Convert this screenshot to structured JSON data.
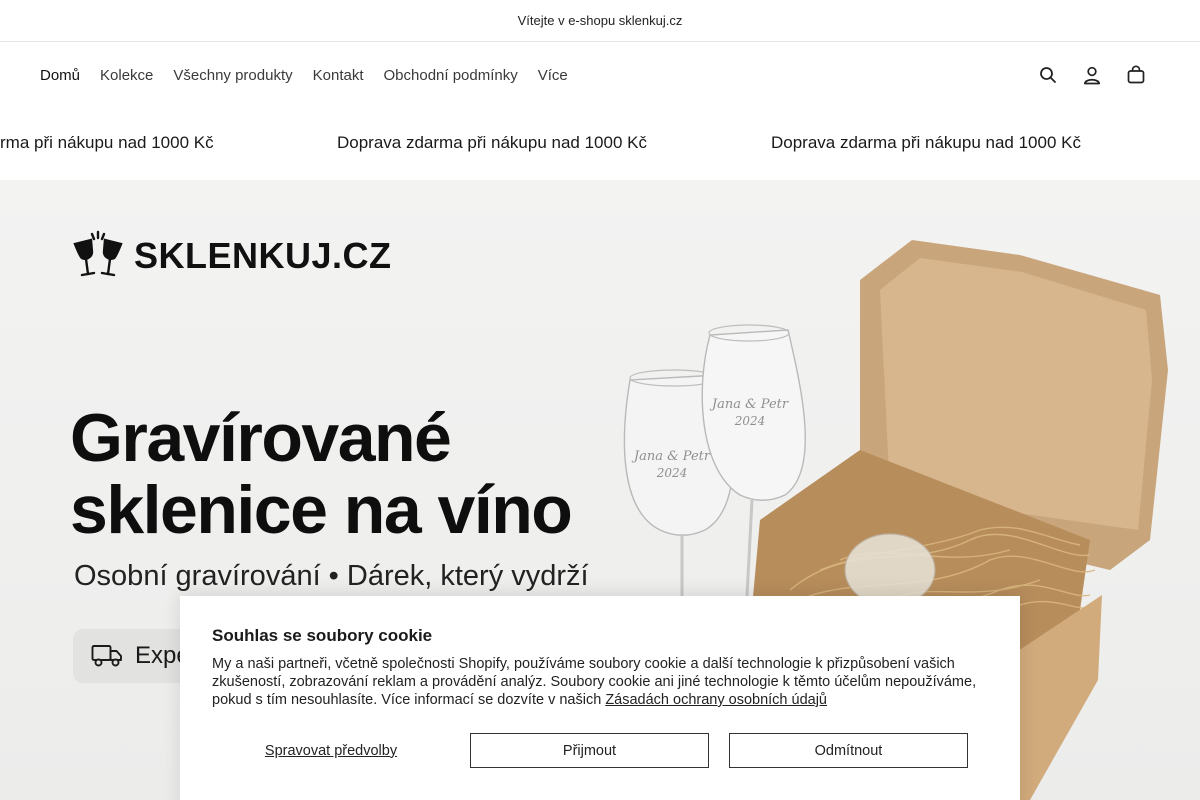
{
  "announcement": "Vítejte v e-shopu sklenkuj.cz",
  "nav": {
    "items": [
      {
        "label": "Domů"
      },
      {
        "label": "Kolekce"
      },
      {
        "label": "Všechny produkty"
      },
      {
        "label": "Kontakt"
      },
      {
        "label": "Obchodní podmínky"
      },
      {
        "label": "Více"
      }
    ],
    "icons": [
      "search-icon",
      "account-icon",
      "cart-icon"
    ]
  },
  "marquee": {
    "text": "Doprava zdarma při nákupu nad 1000 Kč",
    "text_partial": "rma při nákupu nad 1000 Kč"
  },
  "hero": {
    "logo_text": "SKLENKUJ.CZ",
    "title_line1": "Gravírované",
    "title_line2": "sklenice na víno",
    "subtitle": "Osobní gravírování • Dárek, který vydrží",
    "pill_text": "Expe",
    "engraving_line1": "Jana & Petr",
    "engraving_line2": "2024"
  },
  "cookie": {
    "title": "Souhlas se soubory cookie",
    "body": "My a naši partneři, včetně společnosti Shopify, používáme soubory cookie a další technologie k přizpůsobení vašich zkušeností, zobrazování reklam a provádění analýz. Soubory cookie ani jiné technologie k těmto účelům nepoužíváme, pokud s tím nesouhlasíte. Více informací se dozvíte v našich ",
    "policy_link": "Zásadách ochrany osobních údajů",
    "manage_label": "Spravovat předvolby",
    "accept_label": "Přijmout",
    "decline_label": "Odmítnout"
  }
}
